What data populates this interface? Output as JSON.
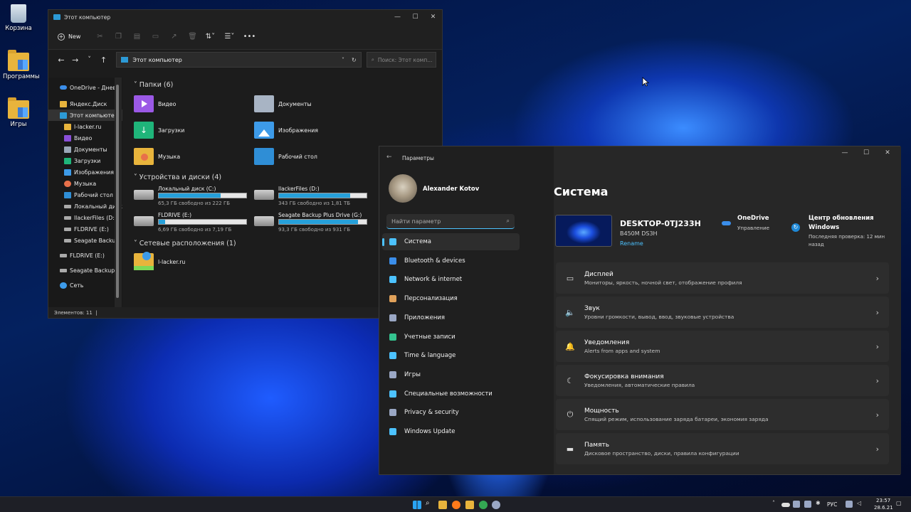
{
  "desktop": {
    "icons": [
      {
        "label": "Корзина"
      },
      {
        "label": "Программы"
      },
      {
        "label": "Игры"
      }
    ]
  },
  "explorer": {
    "title": "Этот компьютер",
    "new_label": "New",
    "address": "Этот компьютер",
    "search_placeholder": "Поиск: Этот комп...",
    "tree": [
      "OneDrive - Дневн",
      "Яндекс.Диск",
      "Этот компьютер",
      "l-lacker.ru",
      "Видео",
      "Документы",
      "Загрузки",
      "Изображения",
      "Музыка",
      "Рабочий стол",
      "Локальный диск",
      "llackerFiles (D:)",
      "FLDRIVE (E:)",
      "Seagate Backup",
      "FLDRIVE (E:)",
      "Seagate Backup P",
      "Сеть"
    ],
    "sections": {
      "folders": "Папки (6)",
      "devices": "Устройства и диски (4)",
      "network": "Сетевые расположения (1)"
    },
    "folders": [
      "Видео",
      "Документы",
      "Загрузки",
      "Изображения",
      "Музыка",
      "Рабочий стол"
    ],
    "drives": [
      {
        "name": "Локальный диск (C:)",
        "free": "65,3 ГБ свободно из 222 ГБ",
        "fill": 0.71
      },
      {
        "name": "llackerFiles (D:)",
        "free": "343 ГБ свободно из 1,81 ТБ",
        "fill": 0.81
      },
      {
        "name": "FLDRIVE (E:)",
        "free": "6,69 ГБ свободно из 7,19 ГБ",
        "fill": 0.07
      },
      {
        "name": "Seagate Backup Plus Drive (G:)",
        "free": "93,3 ГБ свободно из 931 ГБ",
        "fill": 0.9
      }
    ],
    "network": [
      "l-lacker.ru"
    ],
    "status": "Элементов: 11"
  },
  "settings": {
    "title": "Параметры",
    "user": "Alexander Kotov",
    "search_placeholder": "Найти параметр",
    "nav": [
      "Система",
      "Bluetooth & devices",
      "Network & internet",
      "Персонализация",
      "Приложения",
      "Учетные записи",
      "Time & language",
      "Игры",
      "Специальные возможности",
      "Privacy & security",
      "Windows Update"
    ],
    "nav_colors": [
      "#4cc2ff",
      "#3b8eea",
      "#4cc2ff",
      "#e0a15a",
      "#9aa7c4",
      "#34c38f",
      "#4cc2ff",
      "#9aa7c4",
      "#4cc2ff",
      "#9aa7c4",
      "#4cc2ff"
    ],
    "heading": "Система",
    "device": {
      "name": "DESKTOP-0TJ233H",
      "model": "B450M DS3H",
      "rename": "Rename"
    },
    "onedrive": {
      "title": "OneDrive",
      "sub": "Управление"
    },
    "update": {
      "title1": "Центр обновления",
      "title2": "Windows",
      "sub1": "Последняя проверка: 12 мин",
      "sub2": "назад"
    },
    "cards": [
      {
        "title": "Дисплей",
        "sub": "Мониторы, яркость, ночной свет, отображение профиля",
        "icon": "display-icon"
      },
      {
        "title": "Звук",
        "sub": "Уровни громкости, вывод, ввод, звуковые устройства",
        "icon": "speaker-icon"
      },
      {
        "title": "Уведомления",
        "sub": "Alerts from apps and system",
        "icon": "bell-icon"
      },
      {
        "title": "Фокусировка внимания",
        "sub": "Уведомления, автоматические правила",
        "icon": "moon-icon"
      },
      {
        "title": "Мощность",
        "sub": "Спящий режим, использование заряда батареи, экономия заряда",
        "icon": "power-icon"
      },
      {
        "title": "Память",
        "sub": "Дисковое пространство, диски, правила конфигурации",
        "icon": "storage-icon"
      }
    ]
  },
  "taskbar": {
    "lang": "РУС",
    "time": "23:57",
    "date": "28.6.21"
  }
}
